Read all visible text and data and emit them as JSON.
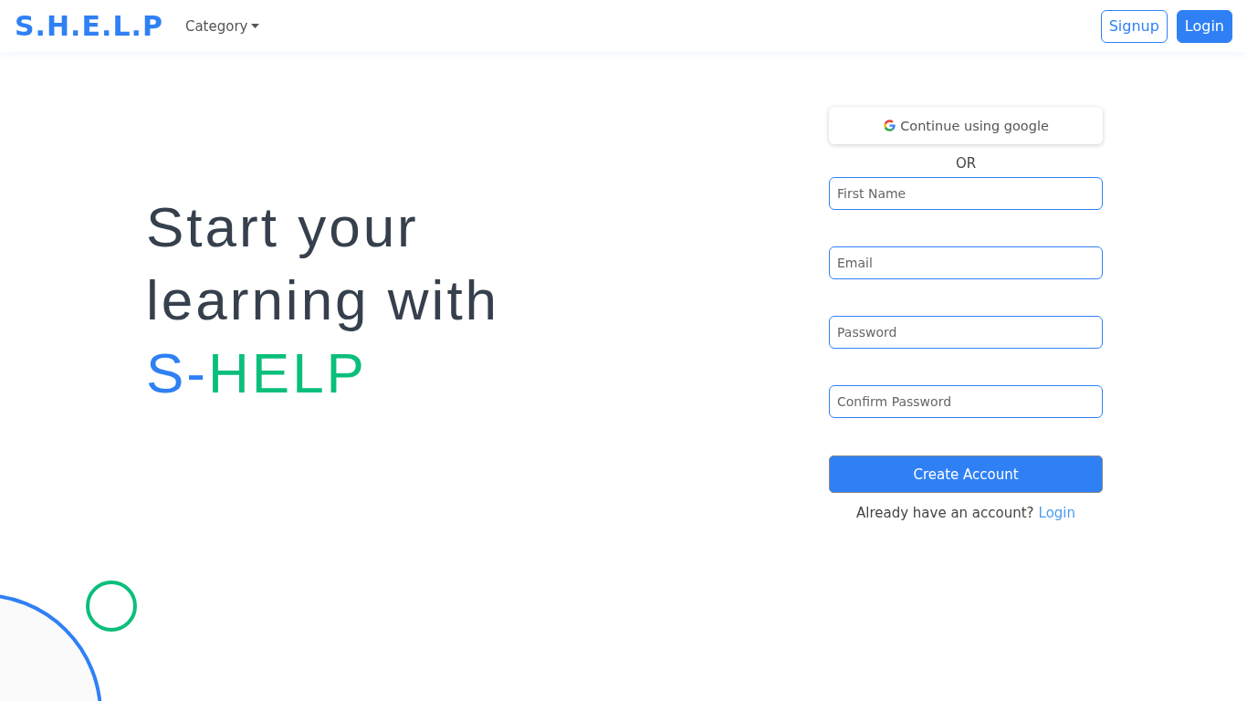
{
  "navbar": {
    "brand": "S.H.E.L.P",
    "menu": {
      "label": "Category"
    },
    "buttons": [
      {
        "label": "Signup",
        "kind": "outline"
      },
      {
        "label": "Login",
        "kind": "solid"
      }
    ]
  },
  "hero": {
    "lines": [
      "Start your",
      "learning with"
    ],
    "brand_parts": [
      {
        "text": "S-",
        "color": "#2f80f5"
      },
      {
        "text": "HELP",
        "color": "#0abf7b"
      }
    ]
  },
  "form": {
    "google_button": "Continue using google",
    "separator": "OR",
    "fields": [
      {
        "placeholder": "First Name"
      },
      {
        "placeholder": "Email"
      },
      {
        "placeholder": "Password"
      },
      {
        "placeholder": "Confirm Password"
      }
    ],
    "submit": "Create Account",
    "footer": {
      "text": "Already have an account?",
      "link": "Login"
    }
  }
}
